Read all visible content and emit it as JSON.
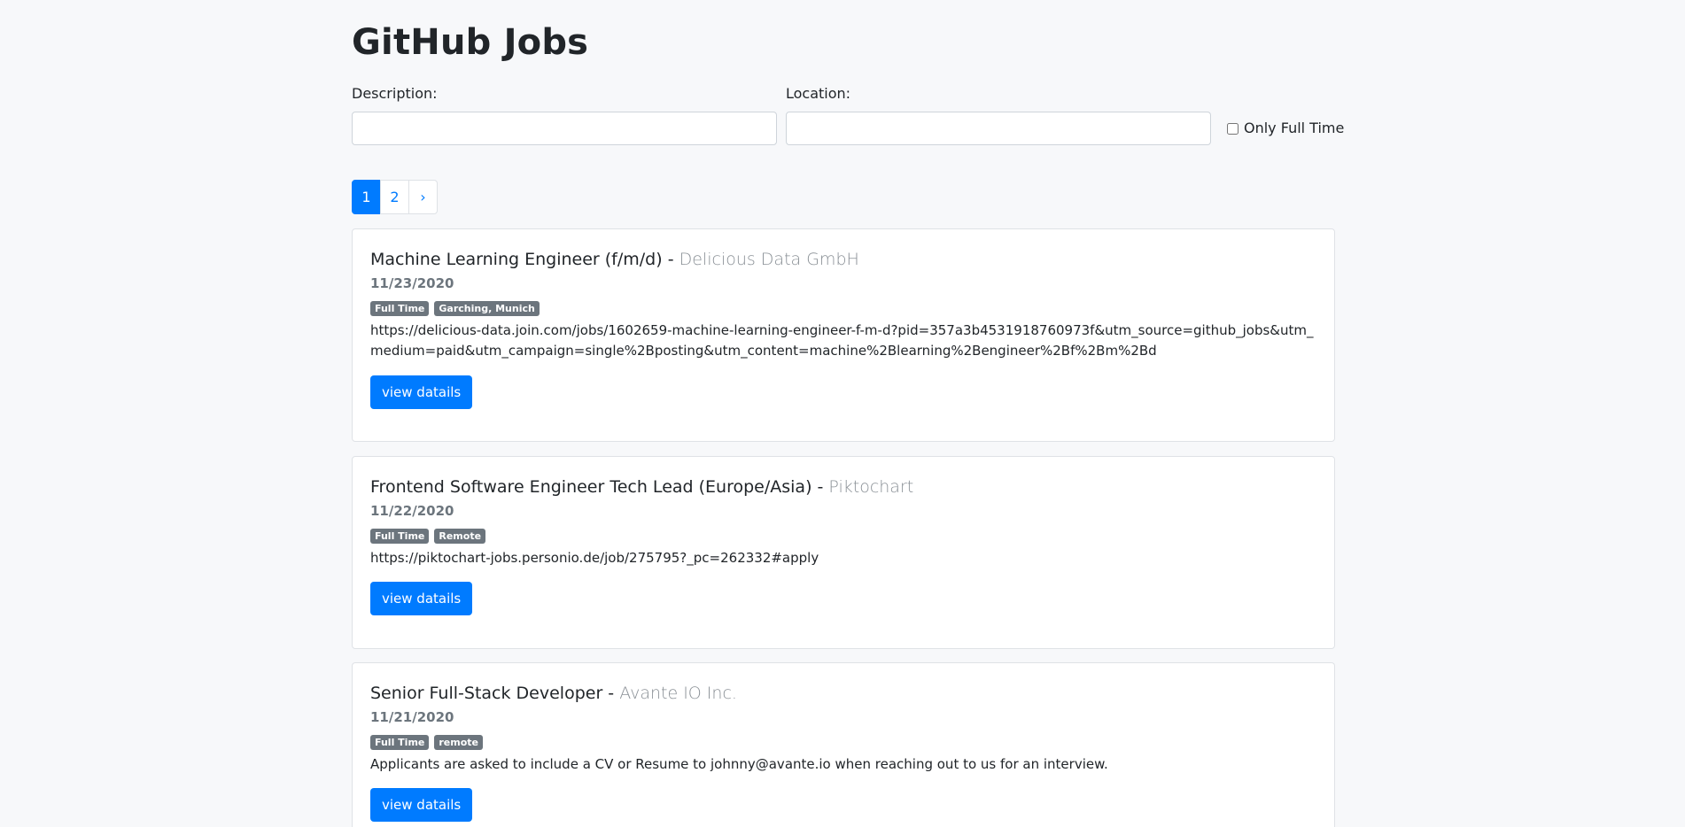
{
  "header": {
    "title": "GitHub Jobs"
  },
  "search": {
    "description_label": "Description:",
    "description_value": "",
    "location_label": "Location:",
    "location_value": "",
    "full_time_label": "Only Full Time",
    "full_time_checked": false
  },
  "pagination": {
    "pages": [
      "1",
      "2",
      "›"
    ],
    "active": "1"
  },
  "jobs": [
    {
      "title": "Machine Learning Engineer (f/m/d)",
      "separator": " - ",
      "company": "Delicious Data GmbH",
      "date": "11/23/2020",
      "badges": [
        "Full Time",
        "Garching, Munich"
      ],
      "description": "https://delicious-data.join.com/jobs/1602659-machine-learning-engineer-f-m-d?pid=357a3b4531918760973f&utm_source=github_jobs&utm_medium=paid&utm_campaign=single%2Bposting&utm_content=machine%2Blearning%2Bengineer%2Bf%2Bm%2Bd",
      "button_label": "view datails"
    },
    {
      "title": "Frontend Software Engineer Tech Lead (Europe/Asia)",
      "separator": " - ",
      "company": "Piktochart",
      "date": "11/22/2020",
      "badges": [
        "Full Time",
        "Remote"
      ],
      "description": "https://piktochart-jobs.personio.de/job/275795?_pc=262332#apply",
      "button_label": "view datails"
    },
    {
      "title": "Senior Full-Stack Developer",
      "separator": " - ",
      "company": "Avante IO Inc.",
      "date": "11/21/2020",
      "badges": [
        "Full Time",
        "remote"
      ],
      "description": "Applicants are asked to include a CV or Resume to johnny@avante.io when reaching out to us for an interview.",
      "button_label": "view datails"
    }
  ]
}
